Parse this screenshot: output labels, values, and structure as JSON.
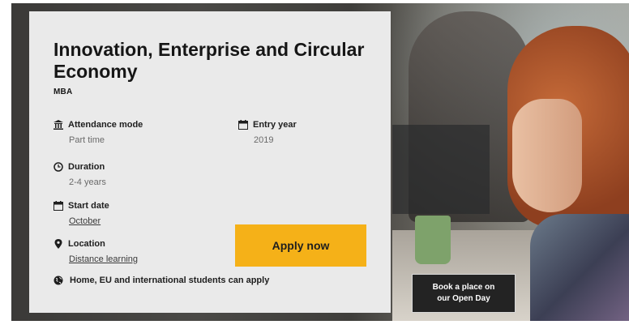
{
  "course": {
    "title": "Innovation, Enterprise and Circular Economy",
    "qualification": "MBA"
  },
  "details": {
    "attendance": {
      "label": "Attendance mode",
      "value": "Part time",
      "icon": "building-icon"
    },
    "entry": {
      "label": "Entry year",
      "value": "2019",
      "icon": "calendar-icon"
    },
    "duration": {
      "label": "Duration",
      "value": "2-4 years",
      "icon": "clock-icon"
    },
    "start": {
      "label": "Start date",
      "value": "October",
      "icon": "calendar-icon"
    },
    "location": {
      "label": "Location",
      "value": "Distance learning",
      "icon": "map-pin-icon"
    }
  },
  "apply_label": "Apply now",
  "eligibility": {
    "text": "Home, EU and international students can apply",
    "icon": "globe-icon"
  },
  "open_day": {
    "line1": "Book a place on",
    "line2": "our Open Day"
  },
  "colors": {
    "apply_button": "#f5b118",
    "card_bg": "#eaeaea",
    "open_day_bg": "#232323"
  }
}
